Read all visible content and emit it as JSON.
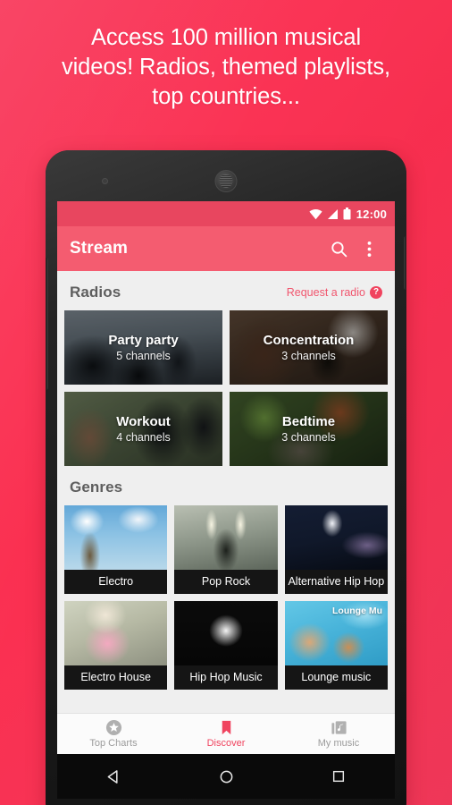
{
  "promo": {
    "headline_line1": "Access 100 million musical",
    "headline_line2": "videos! Radios, themed playlists,",
    "headline_line3": "top countries...",
    "background_color": "#FA2F50",
    "text_color": "#FFFFFF"
  },
  "device": {
    "body_color": "#1B1B1B",
    "earpiece_icon": "speaker-grille-icon",
    "front_camera_icon": "camera-dot-icon",
    "volume_button": "volume-rocker",
    "power_button": "power-button"
  },
  "status_bar": {
    "time": "12:00",
    "icons": [
      "wifi-icon",
      "cell-signal-icon",
      "battery-icon"
    ],
    "background_color": "#E8465F"
  },
  "app_bar": {
    "title": "Stream",
    "background_color": "#F45C70",
    "actions": [
      {
        "name": "search-icon",
        "label": "Search"
      },
      {
        "name": "overflow-menu-icon",
        "label": "More options"
      }
    ]
  },
  "radios_section": {
    "title": "Radios",
    "request_link": "Request a radio",
    "help_badge": "?",
    "link_color": "#F0566E",
    "cards": [
      {
        "name": "Party party",
        "channels": "5 channels",
        "art": "img-party"
      },
      {
        "name": "Concentration",
        "channels": "3 channels",
        "art": "img-concentration"
      },
      {
        "name": "Workout",
        "channels": "4 channels",
        "art": "img-workout"
      },
      {
        "name": "Bedtime",
        "channels": "3 channels",
        "art": "img-bedtime"
      }
    ]
  },
  "genres_section": {
    "title": "Genres",
    "tiles": [
      {
        "label": "Electro",
        "art": "g-electro"
      },
      {
        "label": "Pop Rock",
        "art": "g-poprock"
      },
      {
        "label": "Alternative Hip Hop",
        "art": "g-althiphop"
      },
      {
        "label": "Electro House",
        "art": "g-electrohouse"
      },
      {
        "label": "Hip Hop Music",
        "art": "g-hiphopmusic"
      },
      {
        "label": "Lounge music",
        "art": "g-lounge",
        "overlay_caption": "Lounge Mu"
      }
    ]
  },
  "bottom_nav": {
    "active_color": "#F0445F",
    "inactive_color": "#9B9B9B",
    "items": [
      {
        "label": "Top Charts",
        "icon": "star-circle-icon",
        "active": false
      },
      {
        "label": "Discover",
        "icon": "bookmark-icon",
        "active": true
      },
      {
        "label": "My music",
        "icon": "music-library-icon",
        "active": false
      }
    ]
  },
  "android_nav": {
    "keys": [
      {
        "name": "back-button",
        "icon": "triangle-left-icon"
      },
      {
        "name": "home-button",
        "icon": "circle-icon"
      },
      {
        "name": "recents-button",
        "icon": "square-icon"
      }
    ]
  }
}
